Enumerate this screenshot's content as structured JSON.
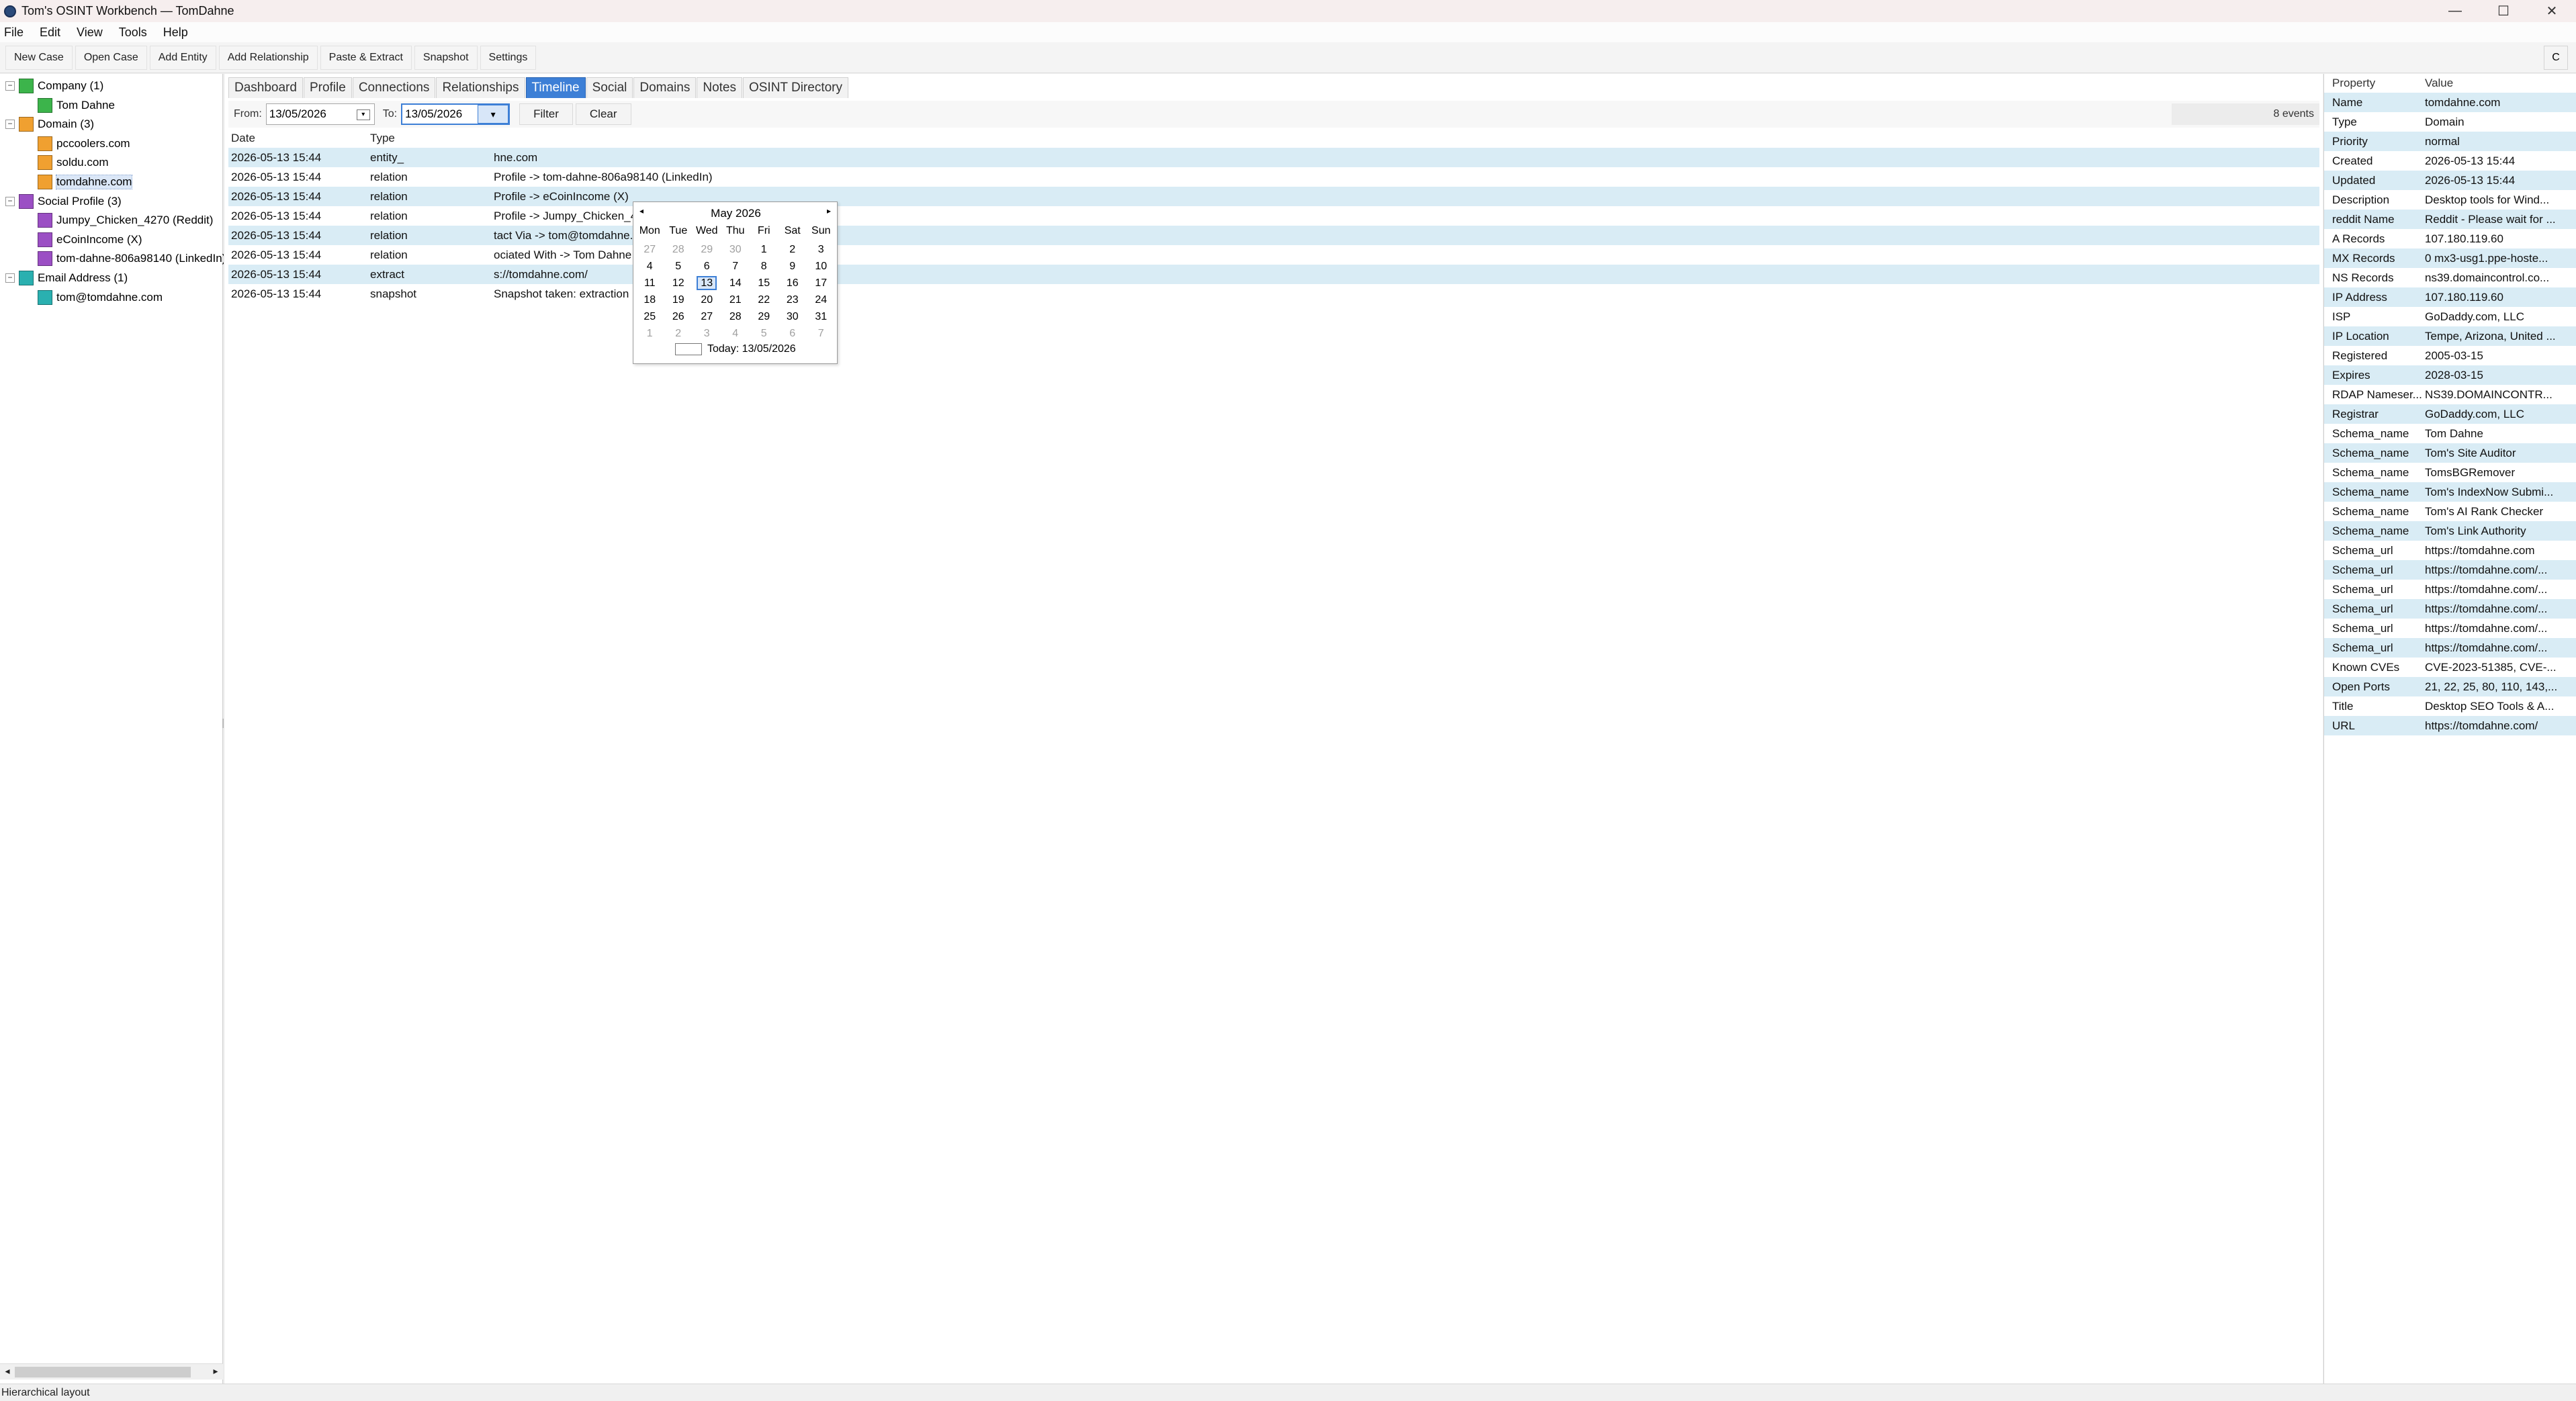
{
  "window": {
    "title": "Tom's OSINT Workbench — TomDahne",
    "controls": [
      "—",
      "☐",
      "✕"
    ]
  },
  "menu": [
    "File",
    "Edit",
    "View",
    "Tools",
    "Help"
  ],
  "toolbar": {
    "buttons": [
      "New Case",
      "Open Case",
      "Add Entity",
      "Add Relationship",
      "Paste & Extract",
      "Snapshot",
      "Settings"
    ],
    "right_button": "C"
  },
  "tree": {
    "nodes": [
      {
        "label": "Company (1)",
        "level": 0,
        "color": "#3cb44b",
        "expander": "−"
      },
      {
        "label": "Tom Dahne",
        "level": 1,
        "color": "#3cb44b"
      },
      {
        "label": "Domain (3)",
        "level": 0,
        "color": "#f0a030",
        "expander": "−"
      },
      {
        "label": "pccoolers.com",
        "level": 1,
        "color": "#f0a030"
      },
      {
        "label": "soldu.com",
        "level": 1,
        "color": "#f0a030"
      },
      {
        "label": "tomdahne.com",
        "level": 1,
        "color": "#f0a030",
        "selected": true
      },
      {
        "label": "Social Profile (3)",
        "level": 0,
        "color": "#9b4fc4",
        "expander": "−"
      },
      {
        "label": "Jumpy_Chicken_4270 (Reddit)",
        "level": 1,
        "color": "#9b4fc4"
      },
      {
        "label": "eCoinIncome (X)",
        "level": 1,
        "color": "#9b4fc4"
      },
      {
        "label": "tom-dahne-806a98140 (LinkedIn)",
        "level": 1,
        "color": "#9b4fc4"
      },
      {
        "label": "Email Address (1)",
        "level": 0,
        "color": "#2ab0b0",
        "expander": "−"
      },
      {
        "label": "tom@tomdahne.com",
        "level": 1,
        "color": "#2ab0b0"
      }
    ]
  },
  "tabs": [
    "Dashboard",
    "Profile",
    "Connections",
    "Relationships",
    "Timeline",
    "Social",
    "Domains",
    "Notes",
    "OSINT Directory"
  ],
  "active_tab": "Timeline",
  "filter": {
    "from_label": "From:",
    "from_value": "13/05/2026",
    "to_label": "To:",
    "to_value": "13/05/2026",
    "filter_button": "Filter",
    "clear_button": "Clear",
    "events_count": "8 events"
  },
  "timeline": {
    "columns": [
      "Date",
      "Type",
      ""
    ],
    "rows": [
      {
        "date": "2026-05-13 15:44",
        "type": "entity_",
        "detail": "hne.com"
      },
      {
        "date": "2026-05-13 15:44",
        "type": "relation",
        "detail": "Profile -> tom-dahne-806a98140 (LinkedIn)"
      },
      {
        "date": "2026-05-13 15:44",
        "type": "relation",
        "detail": "Profile -> eCoinIncome (X)"
      },
      {
        "date": "2026-05-13 15:44",
        "type": "relation",
        "detail": "Profile -> Jumpy_Chicken_4270 (Reddit)"
      },
      {
        "date": "2026-05-13 15:44",
        "type": "relation",
        "detail": "tact Via -> tom@tomdahne.com"
      },
      {
        "date": "2026-05-13 15:44",
        "type": "relation",
        "detail": "ociated With -> Tom Dahne"
      },
      {
        "date": "2026-05-13 15:44",
        "type": "extract",
        "detail": "s://tomdahne.com/"
      },
      {
        "date": "2026-05-13 15:44",
        "type": "snapshot",
        "detail": "Snapshot taken: extraction"
      }
    ]
  },
  "calendar": {
    "month_label": "May 2026",
    "prev": "◂",
    "next": "▸",
    "weekdays": [
      "Mon",
      "Tue",
      "Wed",
      "Thu",
      "Fri",
      "Sat",
      "Sun"
    ],
    "weeks": [
      [
        {
          "d": "27",
          "m": true
        },
        {
          "d": "28",
          "m": true
        },
        {
          "d": "29",
          "m": true
        },
        {
          "d": "30",
          "m": true
        },
        {
          "d": "1"
        },
        {
          "d": "2"
        },
        {
          "d": "3"
        }
      ],
      [
        {
          "d": "4"
        },
        {
          "d": "5"
        },
        {
          "d": "6"
        },
        {
          "d": "7"
        },
        {
          "d": "8"
        },
        {
          "d": "9"
        },
        {
          "d": "10"
        }
      ],
      [
        {
          "d": "11"
        },
        {
          "d": "12"
        },
        {
          "d": "13",
          "today": true
        },
        {
          "d": "14"
        },
        {
          "d": "15"
        },
        {
          "d": "16"
        },
        {
          "d": "17"
        }
      ],
      [
        {
          "d": "18"
        },
        {
          "d": "19"
        },
        {
          "d": "20"
        },
        {
          "d": "21"
        },
        {
          "d": "22"
        },
        {
          "d": "23"
        },
        {
          "d": "24"
        }
      ],
      [
        {
          "d": "25"
        },
        {
          "d": "26"
        },
        {
          "d": "27"
        },
        {
          "d": "28"
        },
        {
          "d": "29"
        },
        {
          "d": "30"
        },
        {
          "d": "31"
        }
      ],
      [
        {
          "d": "1",
          "m": true
        },
        {
          "d": "2",
          "m": true
        },
        {
          "d": "3",
          "m": true
        },
        {
          "d": "4",
          "m": true
        },
        {
          "d": "5",
          "m": true
        },
        {
          "d": "6",
          "m": true
        },
        {
          "d": "7",
          "m": true
        }
      ]
    ],
    "today_label": "Today: 13/05/2026"
  },
  "properties": {
    "headers": [
      "Property",
      "Value"
    ],
    "rows": [
      [
        "Name",
        "tomdahne.com"
      ],
      [
        "Type",
        "Domain"
      ],
      [
        "Priority",
        "normal"
      ],
      [
        "Created",
        "2026-05-13 15:44"
      ],
      [
        "Updated",
        "2026-05-13 15:44"
      ],
      [
        "Description",
        "Desktop tools for Wind..."
      ],
      [
        "reddit Name",
        "Reddit - Please wait for ..."
      ],
      [
        "A Records",
        "107.180.119.60"
      ],
      [
        "MX Records",
        "0 mx3-usg1.ppe-hoste..."
      ],
      [
        "NS Records",
        "ns39.domaincontrol.co..."
      ],
      [
        "IP Address",
        "107.180.119.60"
      ],
      [
        "ISP",
        "GoDaddy.com, LLC"
      ],
      [
        "IP Location",
        "Tempe, Arizona, United ..."
      ],
      [
        "Registered",
        "2005-03-15"
      ],
      [
        "Expires",
        "2028-03-15"
      ],
      [
        "RDAP Nameser...",
        "NS39.DOMAINCONTR..."
      ],
      [
        "Registrar",
        "GoDaddy.com, LLC"
      ],
      [
        "Schema_name",
        "Tom Dahne"
      ],
      [
        "Schema_name",
        "Tom's Site Auditor"
      ],
      [
        "Schema_name",
        "TomsBGRemover"
      ],
      [
        "Schema_name",
        "Tom's IndexNow Submi..."
      ],
      [
        "Schema_name",
        "Tom's AI Rank Checker"
      ],
      [
        "Schema_name",
        "Tom's Link Authority"
      ],
      [
        "Schema_url",
        "https://tomdahne.com"
      ],
      [
        "Schema_url",
        "https://tomdahne.com/..."
      ],
      [
        "Schema_url",
        "https://tomdahne.com/..."
      ],
      [
        "Schema_url",
        "https://tomdahne.com/..."
      ],
      [
        "Schema_url",
        "https://tomdahne.com/..."
      ],
      [
        "Schema_url",
        "https://tomdahne.com/..."
      ],
      [
        "Known CVEs",
        "CVE-2023-51385, CVE-..."
      ],
      [
        "Open Ports",
        "21, 22, 25, 80, 110, 143,..."
      ],
      [
        "Title",
        "Desktop SEO Tools & A..."
      ],
      [
        "URL",
        "https://tomdahne.com/"
      ]
    ]
  },
  "status": "Hierarchical layout",
  "colors": {
    "accent": "#3d7fd6",
    "row_alt": "#d9ecf5"
  }
}
